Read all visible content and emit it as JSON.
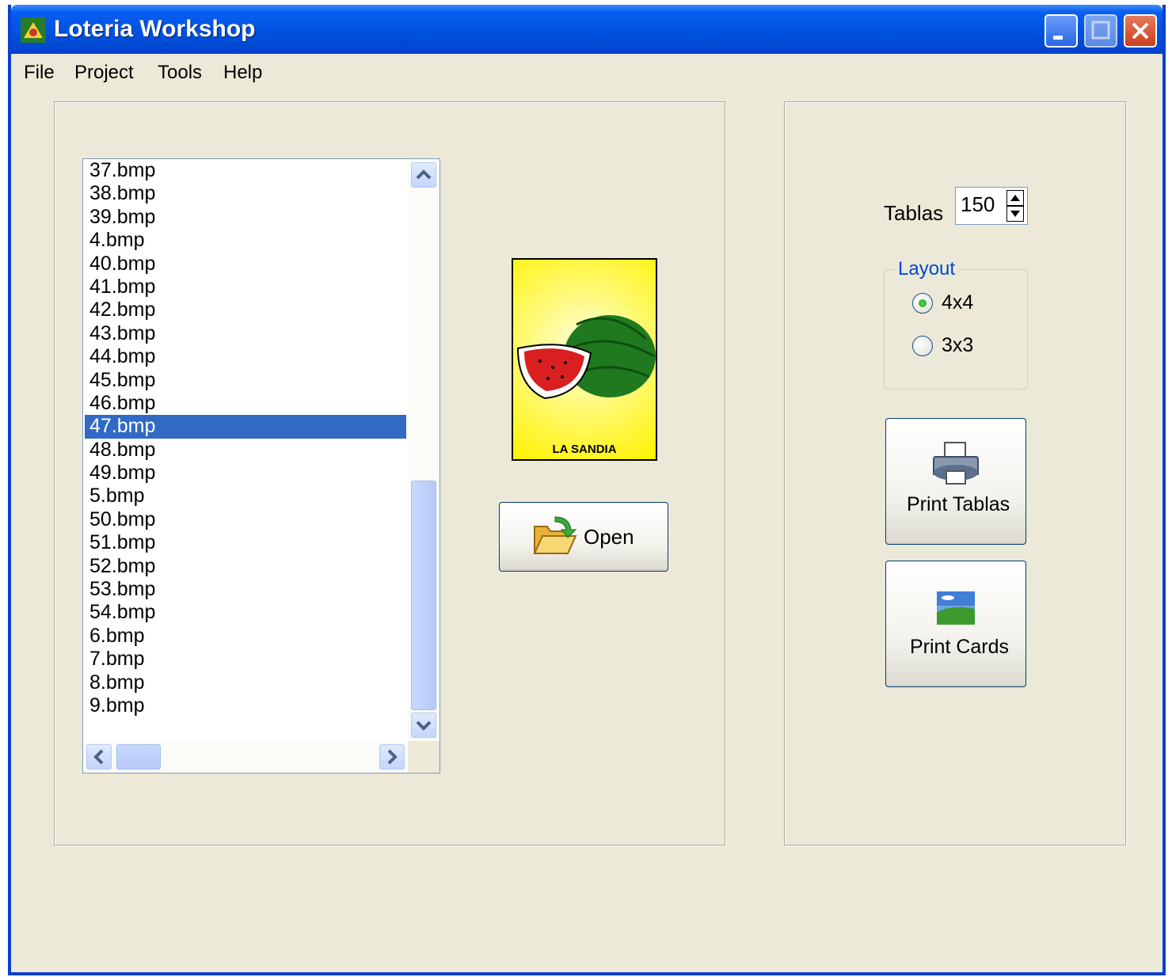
{
  "window": {
    "title": "Loteria Workshop"
  },
  "menu": [
    "File",
    "Project",
    "Tools",
    "Help"
  ],
  "file_list": {
    "items": [
      "37.bmp",
      "38.bmp",
      "39.bmp",
      "4.bmp",
      "40.bmp",
      "41.bmp",
      "42.bmp",
      "43.bmp",
      "44.bmp",
      "45.bmp",
      "46.bmp",
      "47.bmp",
      "48.bmp",
      "49.bmp",
      "5.bmp",
      "50.bmp",
      "51.bmp",
      "52.bmp",
      "53.bmp",
      "54.bmp",
      "6.bmp",
      "7.bmp",
      "8.bmp",
      "9.bmp"
    ],
    "selected": "47.bmp"
  },
  "preview": {
    "caption": "LA SANDIA"
  },
  "open_button": {
    "label": "Open"
  },
  "tablas": {
    "label": "Tablas",
    "value": "150"
  },
  "layout": {
    "legend": "Layout",
    "options": [
      "4x4",
      "3x3"
    ],
    "selected": "4x4"
  },
  "print_tablas_button": {
    "label": "Print Tablas"
  },
  "print_cards_button": {
    "label": "Print Cards"
  },
  "colors": {
    "titlebar": "#0054e3",
    "selection": "#316ac5",
    "window_bg": "#ece9d8",
    "legend_text": "#0046d5"
  }
}
